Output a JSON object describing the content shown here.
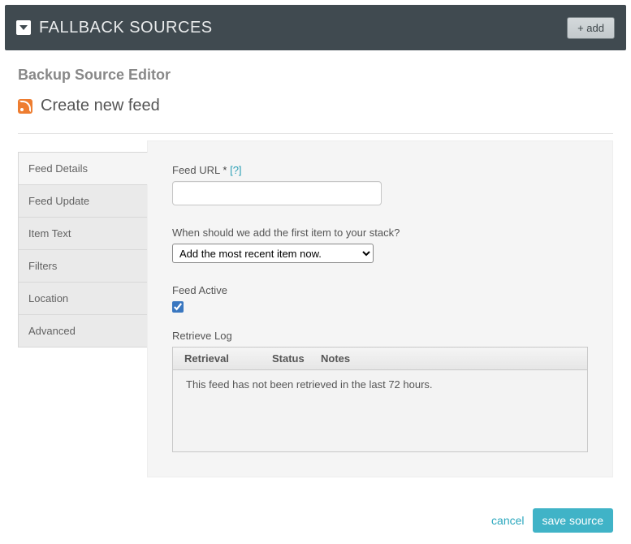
{
  "header": {
    "title": "FALLBACK SOURCES",
    "add_label": "+ add"
  },
  "editor": {
    "title": "Backup Source Editor",
    "subtitle": "Create new feed"
  },
  "tabs": [
    "Feed Details",
    "Feed Update",
    "Item Text",
    "Filters",
    "Location",
    "Advanced"
  ],
  "form": {
    "feed_url_label": "Feed URL",
    "required_mark": "*",
    "help_mark": "[?]",
    "feed_url_value": "",
    "first_item_label": "When should we add the first item to your stack?",
    "first_item_selected": "Add the most recent item now.",
    "feed_active_label": "Feed Active",
    "feed_active_checked": true,
    "retrieve_log_label": "Retrieve Log",
    "log_cols": {
      "retrieval": "Retrieval",
      "status": "Status",
      "notes": "Notes"
    },
    "log_empty": "This feed has not been retrieved in the last 72 hours."
  },
  "footer": {
    "cancel": "cancel",
    "save": "save source"
  }
}
